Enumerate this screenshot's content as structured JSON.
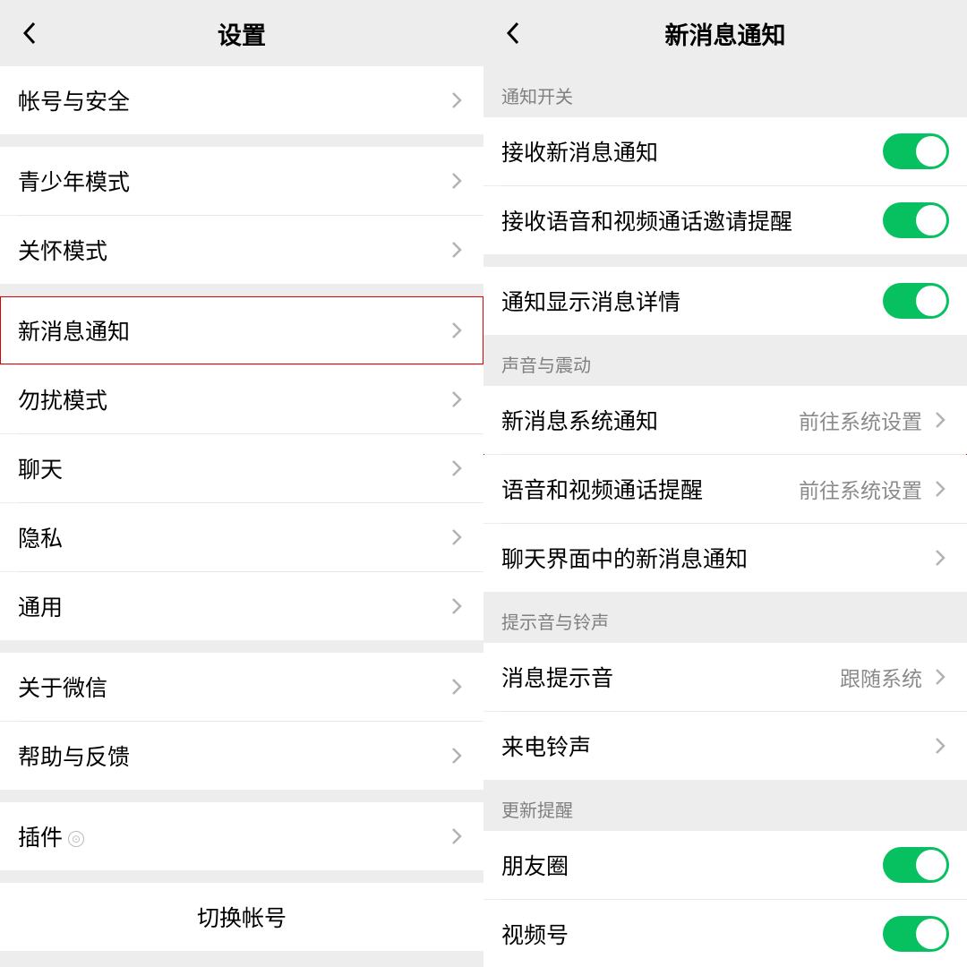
{
  "left": {
    "title": "设置",
    "groups": [
      [
        {
          "label": "帐号与安全",
          "chev": true
        }
      ],
      [
        {
          "label": "青少年模式",
          "chev": true
        },
        {
          "label": "关怀模式",
          "chev": true
        }
      ],
      [
        {
          "label": "新消息通知",
          "chev": true,
          "hi": true
        },
        {
          "label": "勿扰模式",
          "chev": true
        },
        {
          "label": "聊天",
          "chev": true
        },
        {
          "label": "隐私",
          "chev": true
        },
        {
          "label": "通用",
          "chev": true
        }
      ],
      [
        {
          "label": "关于微信",
          "chev": true
        },
        {
          "label": "帮助与反馈",
          "chev": true
        }
      ],
      [
        {
          "label": "插件",
          "chev": true,
          "icon": "plugin"
        }
      ]
    ],
    "switchAccount": "切换帐号"
  },
  "right": {
    "title": "新消息通知",
    "sections": [
      {
        "header": "通知开关",
        "rows": [
          {
            "label": "接收新消息通知",
            "toggle": true
          },
          {
            "label": "接收语音和视频通话邀请提醒",
            "toggle": true
          }
        ]
      },
      {
        "rows": [
          {
            "label": "通知显示消息详情",
            "toggle": true
          }
        ]
      },
      {
        "header": "声音与震动",
        "hiGroup": [
          0,
          1
        ],
        "rows": [
          {
            "label": "新消息系统通知",
            "value": "前往系统设置",
            "chev": true
          },
          {
            "label": "语音和视频通话提醒",
            "value": "前往系统设置",
            "chev": true
          },
          {
            "label": "聊天界面中的新消息通知",
            "chev": true
          }
        ]
      },
      {
        "header": "提示音与铃声",
        "rows": [
          {
            "label": "消息提示音",
            "value": "跟随系统",
            "chev": true
          },
          {
            "label": "来电铃声",
            "chev": true
          }
        ]
      },
      {
        "header": "更新提醒",
        "rows": [
          {
            "label": "朋友圈",
            "toggle": true
          },
          {
            "label": "视频号",
            "toggle": true
          }
        ]
      }
    ]
  }
}
